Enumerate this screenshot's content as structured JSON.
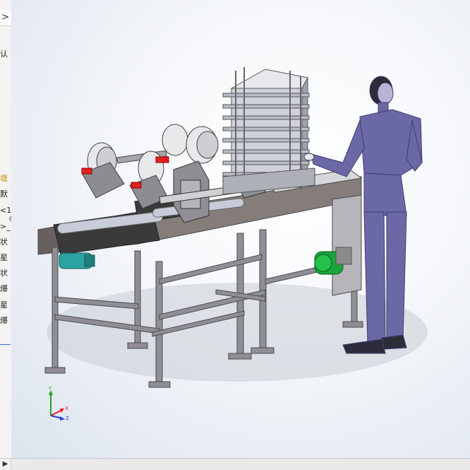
{
  "sidebar": {
    "expand_glyph": ">",
    "items": [
      {
        "label": "认"
      },
      {
        "label": "壥"
      },
      {
        "label": "默"
      },
      {
        "label": "<1"
      },
      {
        "label": ">_"
      },
      {
        "label": "状"
      },
      {
        "label": "星"
      },
      {
        "label": "状"
      },
      {
        "label": "爆"
      },
      {
        "label": "星"
      },
      {
        "label": "爆"
      }
    ]
  },
  "scrollbar": {
    "left_arrow": "▶"
  },
  "triad": {
    "x": "X",
    "y": "Y",
    "z": "Z"
  },
  "colors": {
    "frame": "#8e8e94",
    "plate": "#7a7270",
    "motor": "#1aa33c",
    "gearbox": "#2aa4a0",
    "mannequin": "#6b68a6",
    "belt": "#3a3a3a"
  }
}
